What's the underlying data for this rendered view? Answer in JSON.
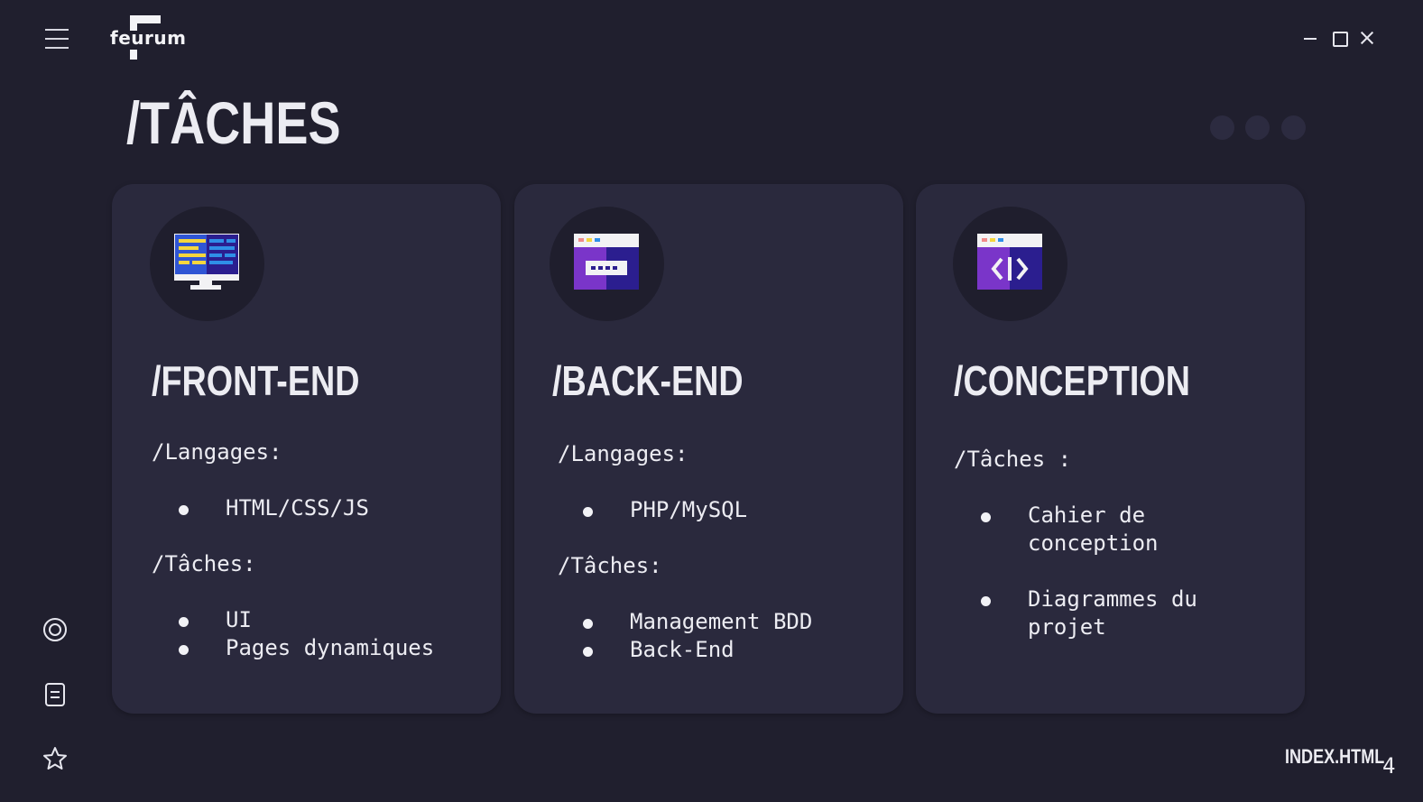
{
  "app": {
    "logo_text": "feurum"
  },
  "page": {
    "title": "/TÂCHES"
  },
  "pager": {
    "count": 3
  },
  "cards": [
    {
      "icon": "monitor-code-icon",
      "title": "/FRONT-END",
      "languages_label": "/Langages:",
      "languages": [
        "HTML/CSS/JS"
      ],
      "tasks_label": "/Tâches:",
      "tasks": [
        "UI",
        "Pages dynamiques"
      ]
    },
    {
      "icon": "browser-server-icon",
      "title": "/BACK-END",
      "languages_label": "/Langages:",
      "languages": [
        "PHP/MySQL"
      ],
      "tasks_label": "/Tâches:",
      "tasks": [
        "Management BDD",
        "Back-End"
      ]
    },
    {
      "icon": "browser-code-icon",
      "title": "/CONCEPTION",
      "tasks_label": "/Tâches :",
      "tasks": [
        "Cahier de\nconception",
        "Diagrammes du\nprojet"
      ]
    }
  ],
  "sidebar": {
    "icons": [
      "target-icon",
      "document-icon",
      "star-icon"
    ]
  },
  "footer": {
    "filename": "INDEX.HTML",
    "page_number": "4"
  },
  "colors": {
    "background": "#201f2e",
    "card": "#2a293d",
    "text": "#ececf2",
    "icon_yellow": "#f5d63d",
    "icon_blue": "#2f55d4",
    "icon_purple": "#7a35c9",
    "icon_navy": "#2b1e8f"
  }
}
